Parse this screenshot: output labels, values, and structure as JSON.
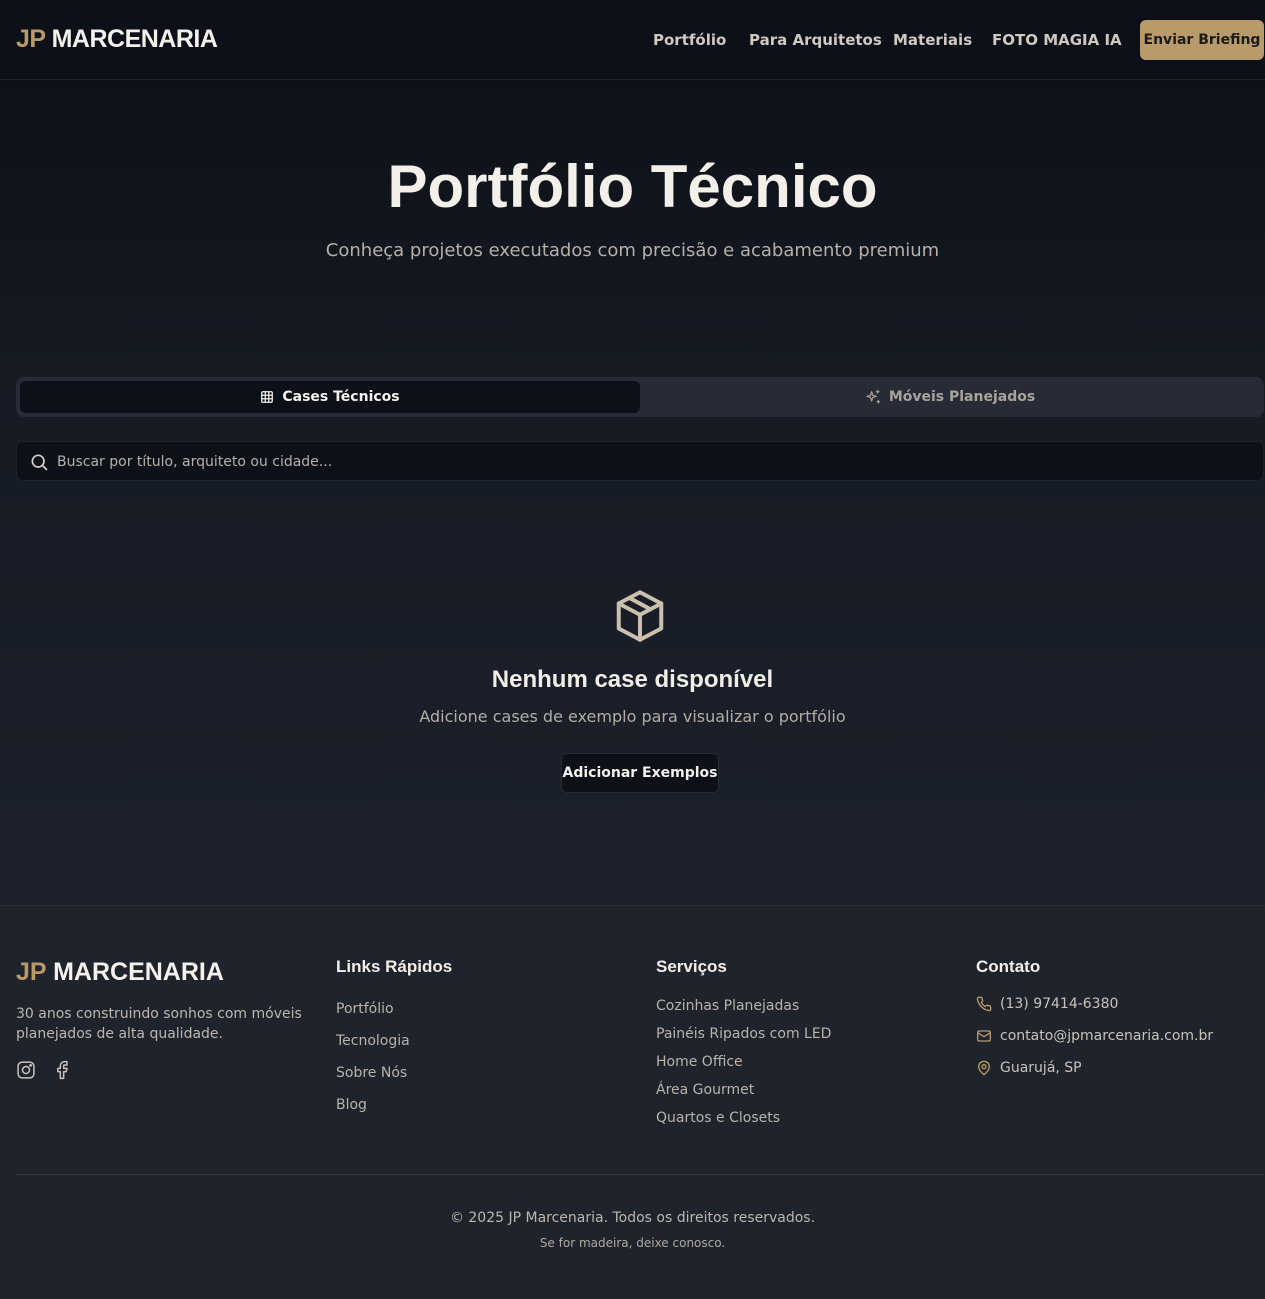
{
  "header": {
    "logo_prefix": "JP",
    "logo_name": "MARCENARIA",
    "nav": [
      "Portfólio",
      "Para Arquitetos",
      "Materiais",
      "FOTO MAGIA IA"
    ],
    "cta": "Enviar Briefing"
  },
  "hero": {
    "title": "Portfólio Técnico",
    "subtitle": "Conheça projetos executados com precisão e acabamento premium"
  },
  "tabs": {
    "cases": "Cases Técnicos",
    "moveis": "Móveis Planejados"
  },
  "search": {
    "placeholder": "Buscar por título, arquiteto ou cidade..."
  },
  "empty": {
    "title": "Nenhum case disponível",
    "subtitle": "Adicione cases de exemplo para visualizar o portfólio",
    "button": "Adicionar Exemplos"
  },
  "footer": {
    "logo_prefix": "JP",
    "logo_name": "MARCENARIA",
    "description": "30 anos construindo sonhos com móveis planejados de alta qualidade.",
    "links_title": "Links Rápidos",
    "links": [
      "Portfólio",
      "Tecnologia",
      "Sobre Nós",
      "Blog"
    ],
    "services_title": "Serviços",
    "services": [
      "Cozinhas Planejadas",
      "Painéis Ripados com LED",
      "Home Office",
      "Área Gourmet",
      "Quartos e Closets"
    ],
    "contact_title": "Contato",
    "phone": "(13) 97414-6380",
    "email": "contato@jpmarcenaria.com.br",
    "location": "Guarujá, SP",
    "copyright": "© 2025 JP Marcenaria. Todos os direitos reservados.",
    "tagline": "Se for madeira, deixe conosco."
  },
  "colors": {
    "accent": "#b99b6b",
    "background": "#0c1018",
    "footer_background": "#1f232c"
  }
}
